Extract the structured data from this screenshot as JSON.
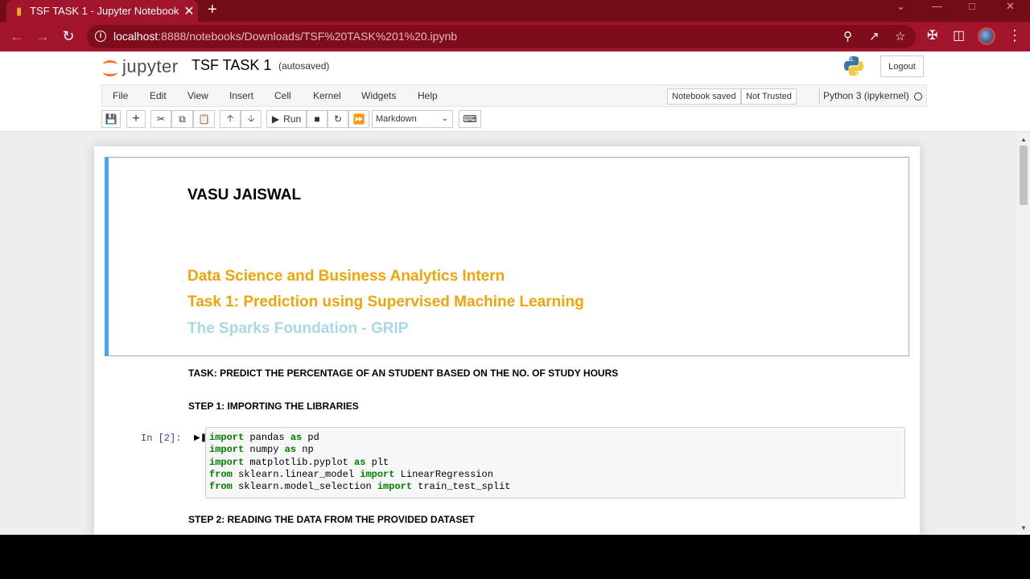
{
  "browser": {
    "tab_title": "TSF TASK 1 - Jupyter Notebook",
    "tab_close": "✕",
    "new_tab": "+",
    "url_host": "localhost",
    "url_path": ":8888/notebooks/Downloads/TSF%20TASK%201%20.ipynb"
  },
  "header": {
    "logo_text": "jupyter",
    "notebook_name": "TSF TASK 1",
    "autosave_status": "(autosaved)",
    "logout_label": "Logout"
  },
  "menu": {
    "items": [
      "File",
      "Edit",
      "View",
      "Insert",
      "Cell",
      "Kernel",
      "Widgets",
      "Help"
    ],
    "notebook_saved": "Notebook saved",
    "trust_status": "Not Trusted",
    "kernel_name": "Python 3 (ipykernel)"
  },
  "toolbar": {
    "run_label": "Run",
    "cell_type": "Markdown"
  },
  "notebook": {
    "author": "VASU JAISWAL",
    "line1": "Data Science and Business Analytics Intern",
    "line2": "Task 1: Prediction using Supervised Machine Learning",
    "line3": "The Sparks Foundation - GRIP",
    "task_heading": "TASK: PREDICT THE PERCENTAGE OF AN STUDENT BASED ON THE NO. OF STUDY HOURS",
    "step1_heading": "STEP 1: IMPORTING THE LIBRARIES",
    "code_prompt": "In [2]:",
    "code": {
      "l1_kw": "import",
      "l1_rest": " pandas ",
      "l1_kw2": "as",
      "l1_end": " pd",
      "l2_kw": "import",
      "l2_rest": " numpy ",
      "l2_kw2": "as",
      "l2_end": " np",
      "l3_kw": "import",
      "l3_rest": " matplotlib.pyplot ",
      "l3_kw2": "as",
      "l3_end": " plt",
      "l4_kw": "from",
      "l4_rest": " sklearn.linear_model ",
      "l4_kw2": "import",
      "l4_end": " LinearRegression",
      "l5_kw": "from",
      "l5_rest": " sklearn.model_selection ",
      "l5_kw2": "import",
      "l5_end": " train_test_split"
    },
    "step2_heading": "STEP 2: READING THE DATA FROM THE PROVIDED DATASET"
  },
  "colors": {
    "browser_frame": "#a2142a",
    "cell_selected_bar": "#42a5f5",
    "heading_orange": "#f0a30a",
    "heading_light_blue": "#a7d8e6",
    "code_keyword": "#008000"
  },
  "icons": [
    "jupyter-favicon",
    "back-arrow-icon",
    "forward-arrow-icon",
    "reload-icon",
    "info-icon",
    "zoom-icon",
    "share-icon",
    "star-icon",
    "extensions-icon",
    "sidebar-icon",
    "kebab-menu-icon",
    "python-logo",
    "save-icon",
    "plus-icon",
    "cut-icon",
    "copy-icon",
    "paste-icon",
    "move-up-icon",
    "move-down-icon",
    "stop-icon",
    "restart-icon",
    "fast-forward-icon",
    "keyboard-icon",
    "kernel-idle-icon"
  ]
}
